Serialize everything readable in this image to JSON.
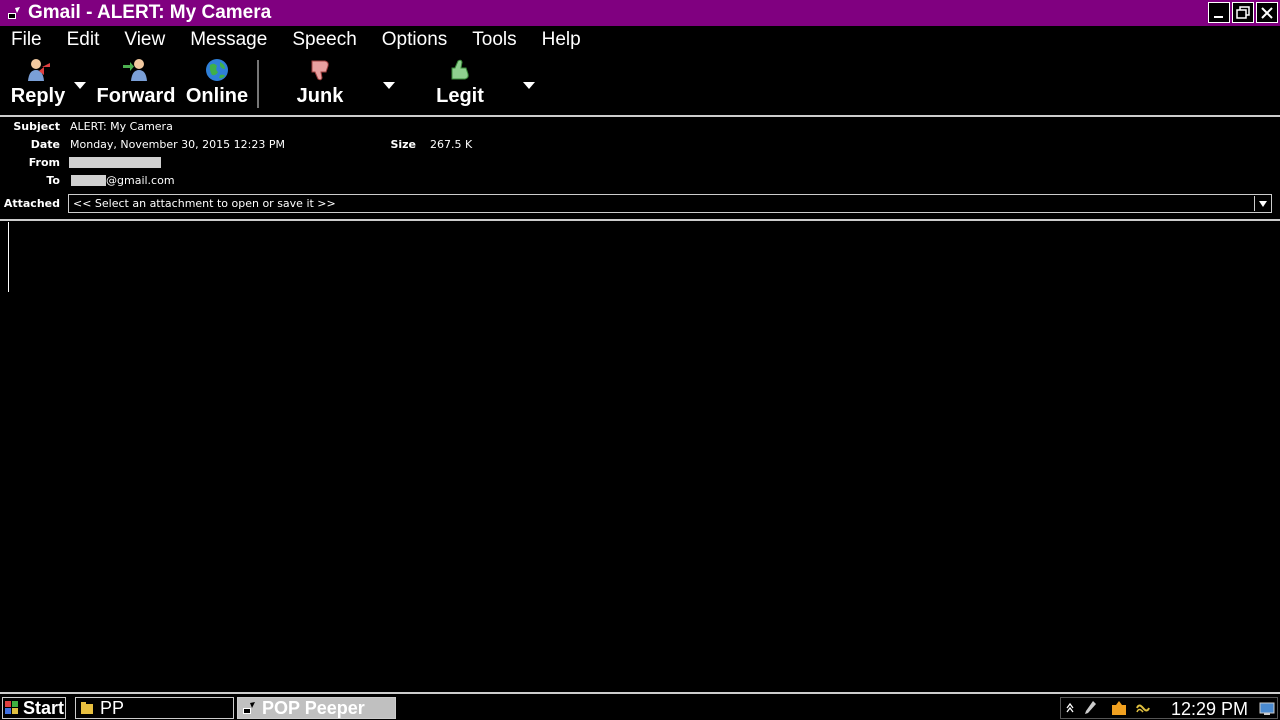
{
  "window": {
    "title": "Gmail - ALERT: My Camera",
    "controls": [
      "minimize-icon",
      "restore-icon",
      "close-icon"
    ]
  },
  "menubar": {
    "items": [
      {
        "label": "File"
      },
      {
        "label": "Edit"
      },
      {
        "label": "View"
      },
      {
        "label": "Message"
      },
      {
        "label": "Speech"
      },
      {
        "label": "Options"
      },
      {
        "label": "Tools"
      },
      {
        "label": "Help"
      }
    ]
  },
  "toolbar": {
    "reply": {
      "label": "Reply",
      "icon": "reply-person-icon"
    },
    "forward": {
      "label": "Forward",
      "icon": "forward-person-icon"
    },
    "online": {
      "label": "Online",
      "icon": "globe-icon"
    },
    "junk": {
      "label": "Junk",
      "icon": "thumbs-down-icon"
    },
    "legit": {
      "label": "Legit",
      "icon": "thumbs-up-icon"
    }
  },
  "message": {
    "labels": {
      "subject": "Subject",
      "date": "Date",
      "size": "Size",
      "from": "From",
      "to": "To",
      "attached": "Attached"
    },
    "subject": "ALERT: My Camera",
    "date": "Monday, November 30, 2015 12:23 PM",
    "size": "267.5 K",
    "from": "",
    "to": "@gmail.com",
    "attachment_placeholder": "<< Select an attachment to open or save it >>"
  },
  "taskbar": {
    "start_label": "Start",
    "tasks": [
      {
        "label": "PP",
        "active": false
      },
      {
        "label": "POP Peeper",
        "active": true
      }
    ],
    "clock": "12:29 PM"
  },
  "colors": {
    "titlebar": "#800080",
    "background": "#000000",
    "text": "#ffffff"
  }
}
